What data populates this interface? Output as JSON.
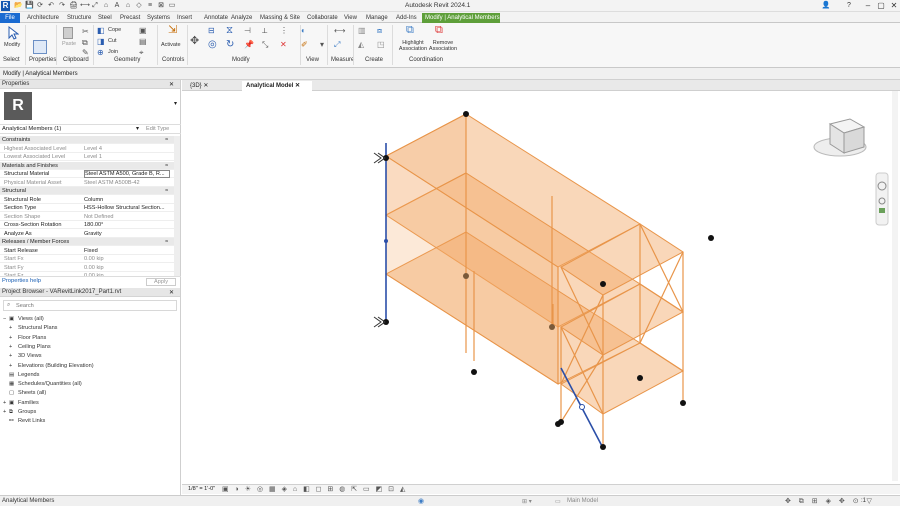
{
  "app": {
    "title": "Autodesk Revit 2024.1",
    "logo": "R"
  },
  "quick_access": [
    "open-icon",
    "save-icon",
    "sync-icon",
    "undo-icon",
    "redo-icon",
    "print-icon",
    "measure-icon",
    "dimension-icon",
    "tag-icon",
    "text-icon",
    "3d-view-icon",
    "section-icon",
    "thin-lines-icon",
    "close-hidden-icon",
    "switch-windows-icon"
  ],
  "ribbon_tabs": [
    "File",
    "Architecture",
    "Structure",
    "Steel",
    "Precast",
    "Systems",
    "Insert",
    "Annotate",
    "Analyze",
    "Massing & Site",
    "Collaborate",
    "View",
    "Manage",
    "Add-Ins",
    "Modify | Analytical Members"
  ],
  "ribbon": {
    "panels": [
      "Select",
      "Properties",
      "Clipboard",
      "Geometry",
      "Controls",
      "Modify",
      "View",
      "Measure",
      "Create",
      "Coordination"
    ],
    "modify_label": "Modify",
    "paste_label": "Paste",
    "cope_label": "Cope",
    "cut_label": "Cut",
    "join_label": "Join",
    "activate_label": "Activate",
    "highlight_label": "Highlight Association",
    "remove_label": "Remove Association"
  },
  "context_bar": {
    "text": "Modify | Analytical Members"
  },
  "properties": {
    "header": "Properties",
    "selector": "Analytical Members (1)",
    "edit_type": "Edit Type",
    "rows": [
      {
        "k": "Constraints",
        "v": "",
        "group": true
      },
      {
        "k": "Highest Associated Level",
        "v": "Level 4",
        "grey": true
      },
      {
        "k": "Lowest Associated Level",
        "v": "Level 1",
        "grey": true
      },
      {
        "k": "Materials and Finishes",
        "v": "",
        "group": true
      },
      {
        "k": "Structural Material",
        "v": "Steel ASTM A500, Grade B, R..."
      },
      {
        "k": "Physical Material Asset",
        "v": "Steel ASTM A500B-42",
        "grey": true
      },
      {
        "k": "Structural",
        "v": "",
        "group": true
      },
      {
        "k": "Structural Role",
        "v": "Column"
      },
      {
        "k": "Section Type",
        "v": "HSS-Hollow Structural Section..."
      },
      {
        "k": "Section Shape",
        "v": "Not Defined",
        "grey": true
      },
      {
        "k": "Cross-Section Rotation",
        "v": "180.00°"
      },
      {
        "k": "Analyze As",
        "v": "Gravity"
      },
      {
        "k": "Releases / Member Forces",
        "v": "",
        "group": true
      },
      {
        "k": "Start Release",
        "v": "Fixed"
      },
      {
        "k": "Start Fx",
        "v": "0.00 kip",
        "grey": true
      },
      {
        "k": "Start Fy",
        "v": "0.00 kip",
        "grey": true
      },
      {
        "k": "Start Fz",
        "v": "0.00 kip",
        "grey": true
      }
    ],
    "help": "Properties help",
    "apply": "Apply"
  },
  "browser": {
    "header": "Project Browser - VARevitLink2017_Part1.rvt",
    "search": "Search",
    "items": [
      {
        "label": "Views (all)",
        "indent": 0,
        "exp": "−"
      },
      {
        "label": "Structural Plans",
        "indent": 1,
        "exp": "+"
      },
      {
        "label": "Floor Plans",
        "indent": 1,
        "exp": "+"
      },
      {
        "label": "Ceiling Plans",
        "indent": 1,
        "exp": "+"
      },
      {
        "label": "3D Views",
        "indent": 1,
        "exp": "+"
      },
      {
        "label": "Elevations (Building Elevation)",
        "indent": 1,
        "exp": "+"
      },
      {
        "label": "Legends",
        "indent": 0,
        "exp": ""
      },
      {
        "label": "Schedules/Quantities (all)",
        "indent": 0,
        "exp": ""
      },
      {
        "label": "Sheets (all)",
        "indent": 0,
        "exp": ""
      },
      {
        "label": "Families",
        "indent": 0,
        "exp": "+"
      },
      {
        "label": "Groups",
        "indent": 0,
        "exp": "+"
      },
      {
        "label": "Revit Links",
        "indent": 0,
        "exp": ""
      }
    ]
  },
  "view_tabs": [
    {
      "label": "{3D}"
    },
    {
      "label": "Analytical Model"
    }
  ],
  "view_bar": {
    "scale": "1/8\" = 1'-0\""
  },
  "status": {
    "left": "Analytical Members",
    "model": "Main Model",
    "filter": ":1"
  },
  "colors": {
    "accent": "#1a6bd1",
    "context_tab": "#5e9f3a",
    "member": "#e8954a",
    "surface": "#f7c9a0",
    "selected": "#2b4fa8"
  }
}
